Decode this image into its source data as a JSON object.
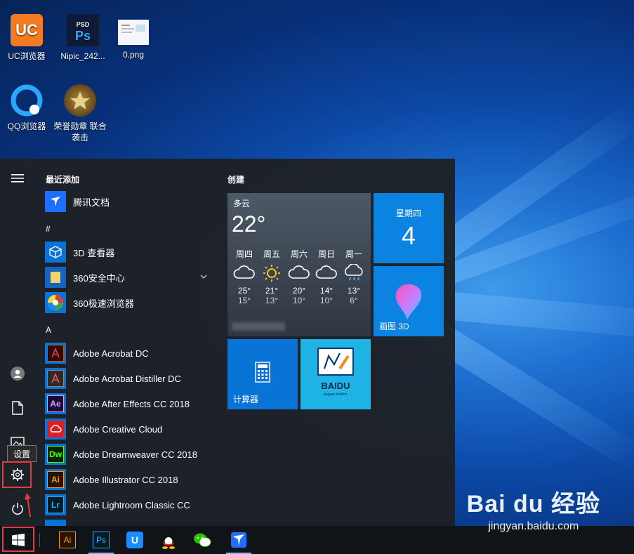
{
  "desktop": {
    "icons": [
      {
        "label": "UC浏览器",
        "icon": "uc-browser-icon"
      },
      {
        "label": "Nipic_242...",
        "icon": "psd-file-icon",
        "badge": "PSD",
        "glyph": "Ps"
      },
      {
        "label": "0.png",
        "icon": "png-file-icon"
      },
      {
        "label": "QQ浏览器",
        "icon": "qq-browser-icon"
      },
      {
        "label": "荣誉勋章 联合袭击",
        "icon": "game-medal-icon"
      }
    ]
  },
  "start": {
    "recent_title": "最近添加",
    "groups": {
      "hash": "#",
      "a": "A"
    },
    "apps": [
      {
        "label": "腾讯文档",
        "icon": "tencent-docs-icon"
      },
      {
        "label": "3D 查看器",
        "icon": "3d-viewer-icon"
      },
      {
        "label": "360安全中心",
        "icon": "folder-icon"
      },
      {
        "label": "360极速浏览器",
        "icon": "360-browser-icon"
      },
      {
        "label": "Adobe Acrobat DC",
        "icon": "acrobat-icon"
      },
      {
        "label": "Adobe Acrobat Distiller DC",
        "icon": "distiller-icon"
      },
      {
        "label": "Adobe After Effects CC 2018",
        "icon": "after-effects-icon",
        "glyph": "Ae"
      },
      {
        "label": "Adobe Creative Cloud",
        "icon": "creative-cloud-icon"
      },
      {
        "label": "Adobe Dreamweaver CC 2018",
        "icon": "dreamweaver-icon",
        "glyph": "Dw"
      },
      {
        "label": "Adobe Illustrator CC 2018",
        "icon": "illustrator-icon",
        "glyph": "Ai"
      },
      {
        "label": "Adobe Lightroom Classic CC",
        "icon": "lightroom-icon",
        "glyph": "Lr"
      }
    ],
    "tiles_title": "创建",
    "weather": {
      "condition": "多云",
      "temp": "22°",
      "days": [
        {
          "day": "周四",
          "high": "25°",
          "low": "15°",
          "icon": "cloudy-icon"
        },
        {
          "day": "周五",
          "high": "21°",
          "low": "13°",
          "icon": "sunny-icon"
        },
        {
          "day": "周六",
          "high": "20°",
          "low": "10°",
          "icon": "cloudy-icon"
        },
        {
          "day": "周日",
          "high": "14°",
          "low": "10°",
          "icon": "cloudy-icon"
        },
        {
          "day": "周一",
          "high": "13°",
          "low": "6°",
          "icon": "rain-icon"
        }
      ]
    },
    "calendar": {
      "weekday": "星期四",
      "day": "4"
    },
    "paint3d_label": "画图 3D",
    "calculator_label": "计算器",
    "baidu_tile": {
      "brand": "BAIDU",
      "sub": "jingyan toolbox"
    },
    "tooltip": "设置"
  },
  "taskbar": {
    "items": [
      {
        "name": "start",
        "icon": "windows-start-icon"
      },
      {
        "name": "illustrator",
        "icon": "illustrator-icon",
        "glyph": "Ai"
      },
      {
        "name": "photoshop",
        "icon": "photoshop-icon",
        "glyph": "Ps"
      },
      {
        "name": "uplay",
        "icon": "store-bag-icon",
        "glyph": "U"
      },
      {
        "name": "qq",
        "icon": "qq-penguin-icon"
      },
      {
        "name": "wechat",
        "icon": "wechat-icon"
      },
      {
        "name": "tencent-docs",
        "icon": "tencent-docs-icon"
      }
    ]
  },
  "watermark": {
    "brand": "Bai du 经验",
    "url": "jingyan.baidu.com"
  },
  "colors": {
    "accent": "#0078d7",
    "highlight": "#e23c3c",
    "menu_bg": "#1e2126"
  }
}
